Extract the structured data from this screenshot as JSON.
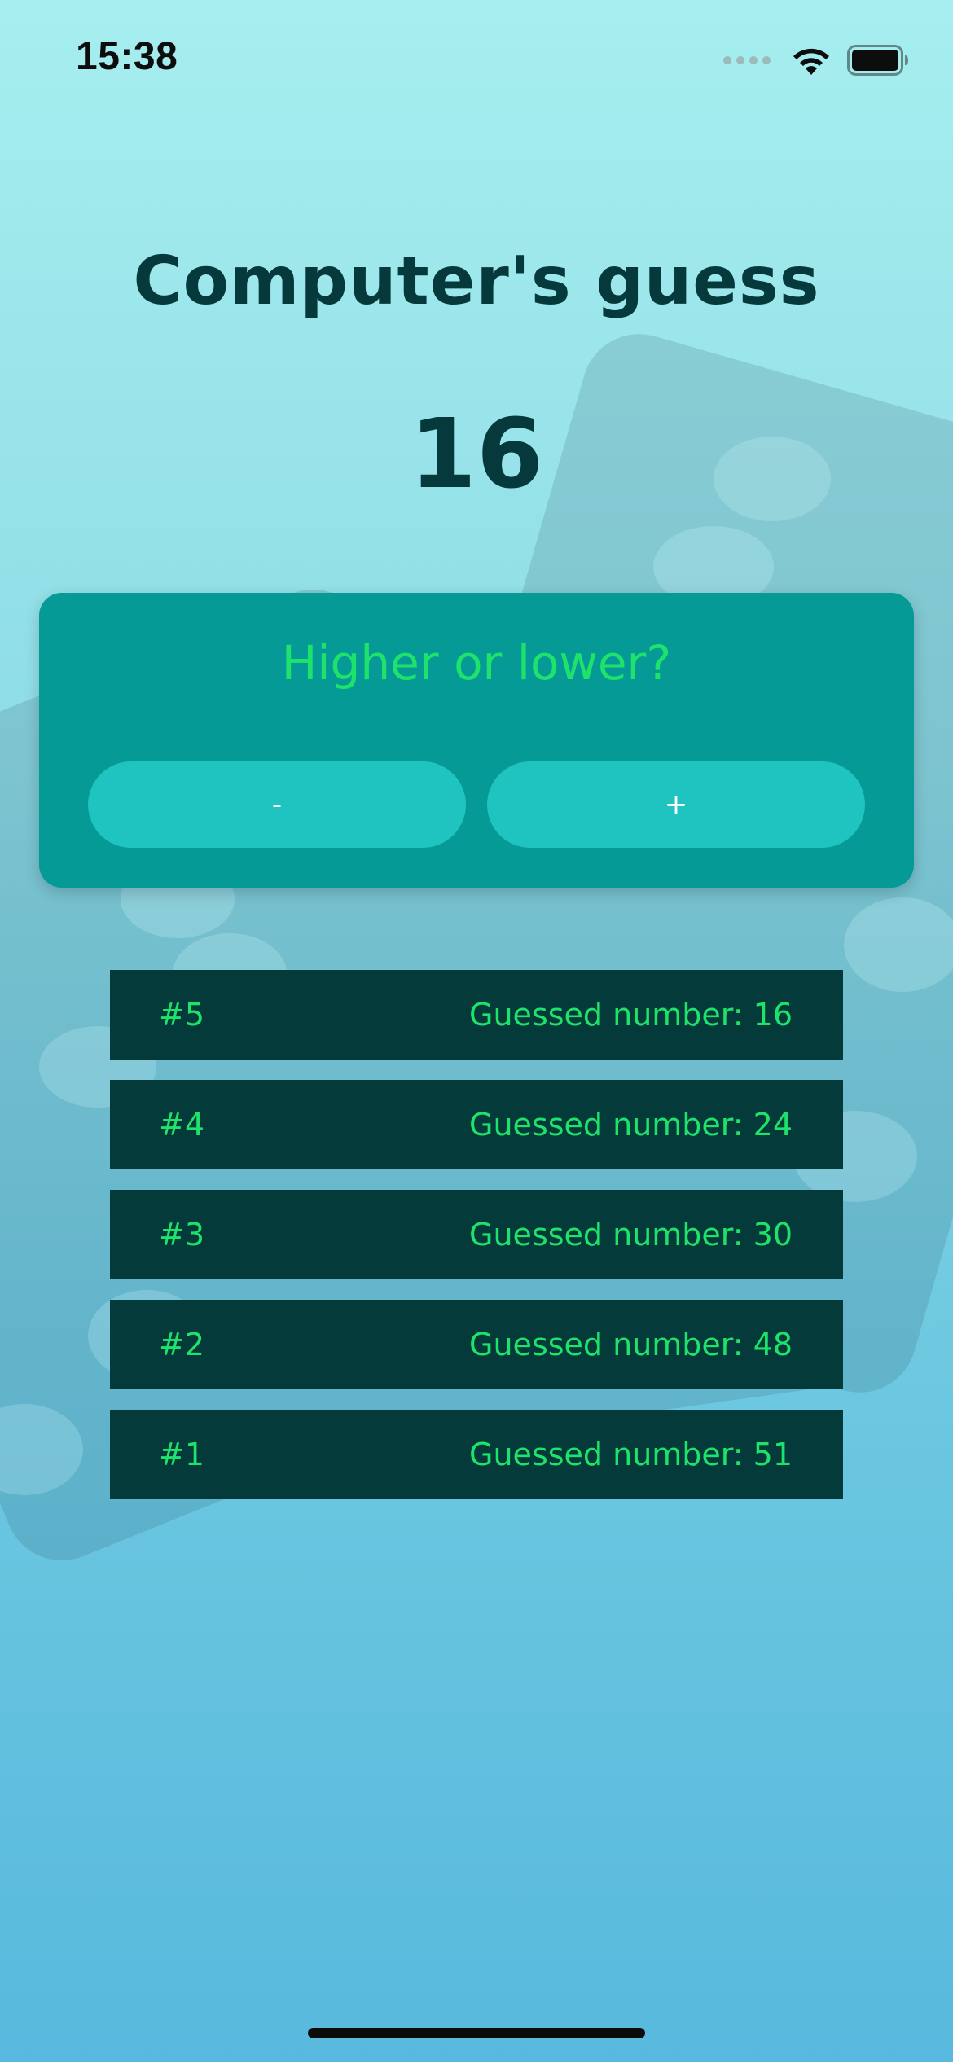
{
  "status_bar": {
    "time": "15:38",
    "icons": [
      "signal-icon",
      "wifi-icon",
      "battery-icon"
    ]
  },
  "screen": {
    "title": "Computer's guess",
    "current_guess": "16"
  },
  "control_card": {
    "question": "Higher or lower?",
    "lower_label": "-",
    "higher_label": "+"
  },
  "guess_log": [
    {
      "index": "#5",
      "text": "Guessed number: 16"
    },
    {
      "index": "#4",
      "text": "Guessed number: 24"
    },
    {
      "index": "#3",
      "text": "Guessed number: 30"
    },
    {
      "index": "#2",
      "text": "Guessed number: 48"
    },
    {
      "index": "#1",
      "text": "Guessed number: 51"
    }
  ],
  "colors": {
    "title": "#05393b",
    "card": "#069a97",
    "button": "#1fc4c1",
    "accent_text": "#1ee36a",
    "log_row": "#043a3a"
  }
}
